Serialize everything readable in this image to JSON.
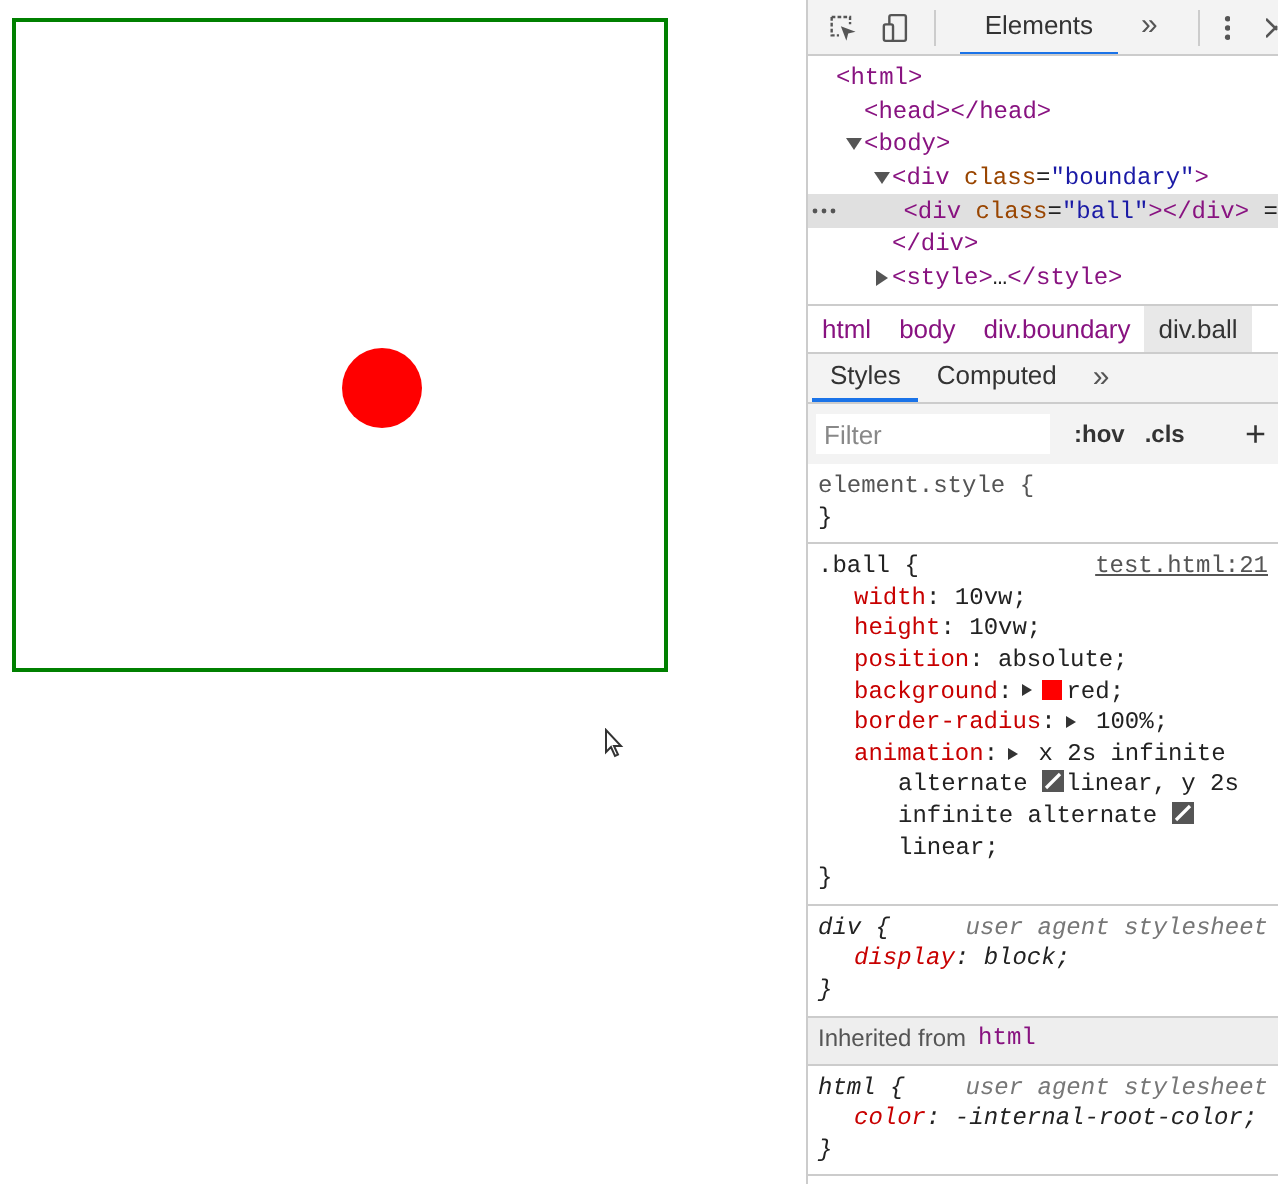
{
  "toolbar": {
    "tabs": [
      {
        "label": "Elements",
        "selected": true
      }
    ],
    "overflow": "»"
  },
  "dom_tree": [
    {
      "selected": false,
      "line": [
        {
          "kind": "tag",
          "text": "<html>"
        }
      ],
      "children": [
        {
          "selected": false,
          "line": [
            {
              "kind": "tag",
              "text": "<head></head>"
            }
          ]
        },
        {
          "selected": false,
          "expanded": true,
          "line": [
            {
              "kind": "tag",
              "text": "<body>"
            }
          ],
          "children": [
            {
              "selected": false,
              "expanded": true,
              "line": [
                {
                  "kind": "tag",
                  "text": "<div"
                },
                {
                  "kind": "attr",
                  "text": " class"
                },
                {
                  "kind": "punct",
                  "text": "="
                },
                {
                  "kind": "value",
                  "text": "\"boundary\""
                },
                {
                  "kind": "tag",
                  "text": ">"
                }
              ],
              "children": [
                {
                  "selected": true,
                  "line": [
                    {
                      "kind": "tag",
                      "text": "<div"
                    },
                    {
                      "kind": "attr",
                      "text": " class"
                    },
                    {
                      "kind": "punct",
                      "text": "="
                    },
                    {
                      "kind": "value",
                      "text": "\"ball\""
                    },
                    {
                      "kind": "tag",
                      "text": "></div>"
                    },
                    {
                      "kind": "punct",
                      "text": " ="
                    }
                  ]
                }
              ],
              "end": [
                {
                  "kind": "tag",
                  "text": "</div>"
                }
              ]
            },
            {
              "selected": false,
              "expanded": false,
              "line": [
                {
                  "kind": "tag",
                  "text": "<style>"
                },
                {
                  "kind": "punct",
                  "text": "…"
                },
                {
                  "kind": "tag",
                  "text": "</style>"
                }
              ]
            }
          ]
        }
      ]
    }
  ],
  "breadcrumbs": [
    {
      "label": "html",
      "selected": false
    },
    {
      "label": "body",
      "selected": false
    },
    {
      "label": "div.boundary",
      "selected": false
    },
    {
      "label": "div.ball",
      "selected": true
    }
  ],
  "styles_tabs": [
    {
      "label": "Styles",
      "selected": true
    },
    {
      "label": "Computed",
      "selected": false
    }
  ],
  "styles_overflow": "»",
  "filter": {
    "placeholder": "Filter",
    "hov": ":hov",
    "cls": ".cls",
    "add": "+"
  },
  "sections": [
    {
      "kind": "rule",
      "muted": true,
      "italic": false,
      "selector": "element.style {",
      "close": "}"
    },
    {
      "kind": "rule",
      "muted": false,
      "italic": false,
      "selector": ".ball {",
      "source": "test.html:21",
      "close": "}",
      "declarations": [
        {
          "property": "width",
          "parts": [
            {
              "kind": "text",
              "text": ": 10vw;"
            }
          ]
        },
        {
          "property": "height",
          "parts": [
            {
              "kind": "text",
              "text": ": 10vw;"
            }
          ]
        },
        {
          "property": "position",
          "parts": [
            {
              "kind": "text",
              "text": ": absolute;"
            }
          ]
        },
        {
          "property": "background",
          "parts": [
            {
              "kind": "text",
              "text": ":"
            },
            {
              "kind": "toggle"
            },
            {
              "kind": "swatch",
              "color": "#ff0000"
            },
            {
              "kind": "text",
              "text": "red;"
            }
          ]
        },
        {
          "property": "border-radius",
          "parts": [
            {
              "kind": "text",
              "text": ":"
            },
            {
              "kind": "toggle"
            },
            {
              "kind": "text",
              "text": " 100%;"
            }
          ]
        },
        {
          "property": "animation",
          "parts": [
            {
              "kind": "text",
              "text": ":"
            },
            {
              "kind": "toggle"
            },
            {
              "kind": "text",
              "text": " x 2s infinite alternate "
            },
            {
              "kind": "easing"
            },
            {
              "kind": "text",
              "text": "linear, y 2s infinite alternate "
            },
            {
              "kind": "easing"
            },
            {
              "kind": "text",
              "text": "linear;"
            }
          ]
        }
      ]
    },
    {
      "kind": "rule",
      "muted": false,
      "italic": true,
      "selector": "div {",
      "source": "user agent stylesheet",
      "close": "}",
      "declarations": [
        {
          "property": "display",
          "parts": [
            {
              "kind": "text",
              "text": ": block;"
            }
          ]
        }
      ]
    },
    {
      "kind": "inherited",
      "label": "Inherited from",
      "tag": "html"
    },
    {
      "kind": "rule",
      "muted": false,
      "italic": true,
      "selector": "html {",
      "source": "user agent stylesheet",
      "close": "}",
      "declarations": [
        {
          "property": "color",
          "parts": [
            {
              "kind": "text",
              "text": ": -internal-root-color;"
            }
          ]
        }
      ]
    }
  ]
}
